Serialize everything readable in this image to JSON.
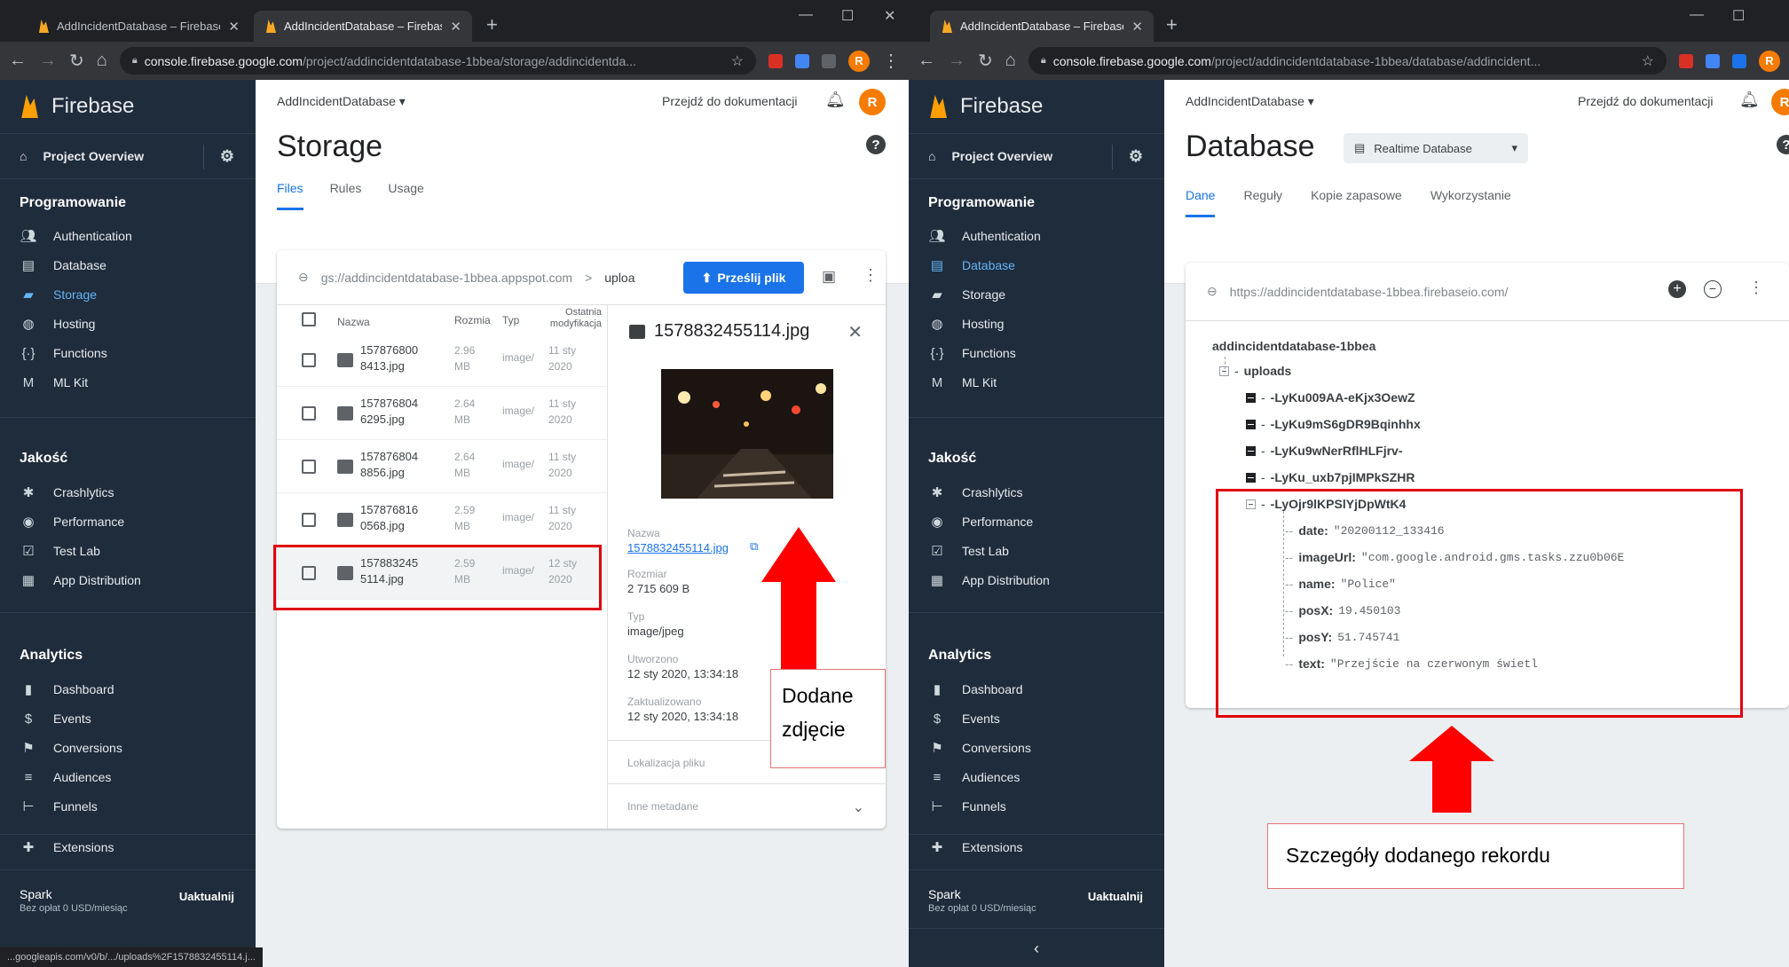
{
  "left": {
    "tabs": [
      "AddIncidentDatabase – Firebase",
      "AddIncidentDatabase – Firebase"
    ],
    "url_host": "console.firebase.google.com",
    "url_path": "/project/addincidentdatabase-1bbea/storage/addincidentda...",
    "project": "AddIncidentDatabase",
    "docs": "Przejdź do dokumentacji",
    "avatar": "R",
    "title": "Storage",
    "page_tabs": [
      "Files",
      "Rules",
      "Usage"
    ],
    "path": "gs://addincidentdatabase-1bbea.appspot.com",
    "path_sep": ">",
    "path_folder": "uploa",
    "upload_btn": "Prześlij plik",
    "columns": [
      "Nazwa",
      "Rozmia",
      "Typ",
      "Ostatnia modyfikacja"
    ],
    "rows": [
      {
        "name": "1578768008413.jpg",
        "name1": "157876800",
        "name2": "8413.jpg",
        "size1": "2.96",
        "size2": "MB",
        "type": "image/",
        "date1": "11 sty",
        "date2": "2020"
      },
      {
        "name": "1578768046295.jpg",
        "name1": "157876804",
        "name2": "6295.jpg",
        "size1": "2.64",
        "size2": "MB",
        "type": "image/",
        "date1": "11 sty",
        "date2": "2020"
      },
      {
        "name": "1578768048856.jpg",
        "name1": "157876804",
        "name2": "8856.jpg",
        "size1": "2.64",
        "size2": "MB",
        "type": "image/",
        "date1": "11 sty",
        "date2": "2020"
      },
      {
        "name": "1578768160568.jpg",
        "name1": "157876816",
        "name2": "0568.jpg",
        "size1": "2.59",
        "size2": "MB",
        "type": "image/",
        "date1": "11 sty",
        "date2": "2020"
      },
      {
        "name": "1578832455114.jpg",
        "name1": "157883245",
        "name2": "5114.jpg",
        "size1": "2.59",
        "size2": "MB",
        "type": "image/",
        "date1": "12 sty",
        "date2": "2020"
      }
    ],
    "detail": {
      "filename": "1578832455114.jpg",
      "name_label": "Nazwa",
      "name_value": "1578832455114.jpg",
      "size_label": "Rozmiar",
      "size_value": "2 715 609 B",
      "type_label": "Typ",
      "type_value": "image/jpeg",
      "created_label": "Utworzono",
      "created_value": "12 sty 2020, 13:34:18",
      "updated_label": "Zaktualizowano",
      "updated_value": "12 sty 2020, 13:34:18",
      "location": "Lokalizacja pliku",
      "meta": "Inne metadane"
    },
    "note_line1": "Dodane",
    "note_line2": "zdjęcie",
    "status": "...googleapis.com/v0/b/.../uploads%2F1578832455114.j..."
  },
  "right": {
    "tab": "AddIncidentDatabase – Firebase",
    "url_host": "console.firebase.google.com",
    "url_path": "/project/addincidentdatabase-1bbea/database/addincident...",
    "project": "AddIncidentDatabase",
    "docs": "Przejdź do dokumentacji",
    "avatar": "R",
    "title": "Database",
    "db_type": "Realtime Database",
    "page_tabs": [
      "Dane",
      "Reguły",
      "Kopie zapasowe",
      "Wykorzystanie"
    ],
    "db_url": "https://addincidentdatabase-1bbea.firebaseio.com/",
    "root": "addincidentdatabase-1bbea",
    "uploads": "uploads",
    "keys": [
      "-LyKu009AA-eKjx3OewZ",
      "-LyKu9mS6gDR9Bqinhhx",
      "-LyKu9wNerRflHLFjrv-",
      "-LyKu_uxb7pjIMPkSZHR",
      "-LyOjr9lKPSlYjDpWtK4"
    ],
    "fields": [
      {
        "k": "date:",
        "v": "\"20200112_133416"
      },
      {
        "k": "imageUrl:",
        "v": "\"com.google.android.gms.tasks.zzu0b06E"
      },
      {
        "k": "name:",
        "v": "\"Police\""
      },
      {
        "k": "posX:",
        "v": "19.450103"
      },
      {
        "k": "posY:",
        "v": "51.745741"
      },
      {
        "k": "text:",
        "v": "\"Przejście na czerwonym świetl"
      }
    ],
    "note": "Szczegóły dodanego rekordu"
  },
  "sidebar": {
    "brand": "Firebase",
    "overview": "Project Overview",
    "sec1": "Programowanie",
    "dev": [
      "Authentication",
      "Database",
      "Storage",
      "Hosting",
      "Functions",
      "ML Kit"
    ],
    "sec2": "Jakość",
    "quality": [
      "Crashlytics",
      "Performance",
      "Test Lab",
      "App Distribution"
    ],
    "sec3": "Analytics",
    "analytics": [
      "Dashboard",
      "Events",
      "Conversions",
      "Audiences",
      "Funnels"
    ],
    "extensions": "Extensions",
    "plan": "Spark",
    "plan_sub": "Bez opłat 0 USD/miesiąc",
    "upgrade": "Uaktualnij",
    "collapse": "‹"
  },
  "colors": {
    "sidebar": "#1f2c3c",
    "accent": "#1a73e8",
    "annotation": "#e0000a"
  }
}
